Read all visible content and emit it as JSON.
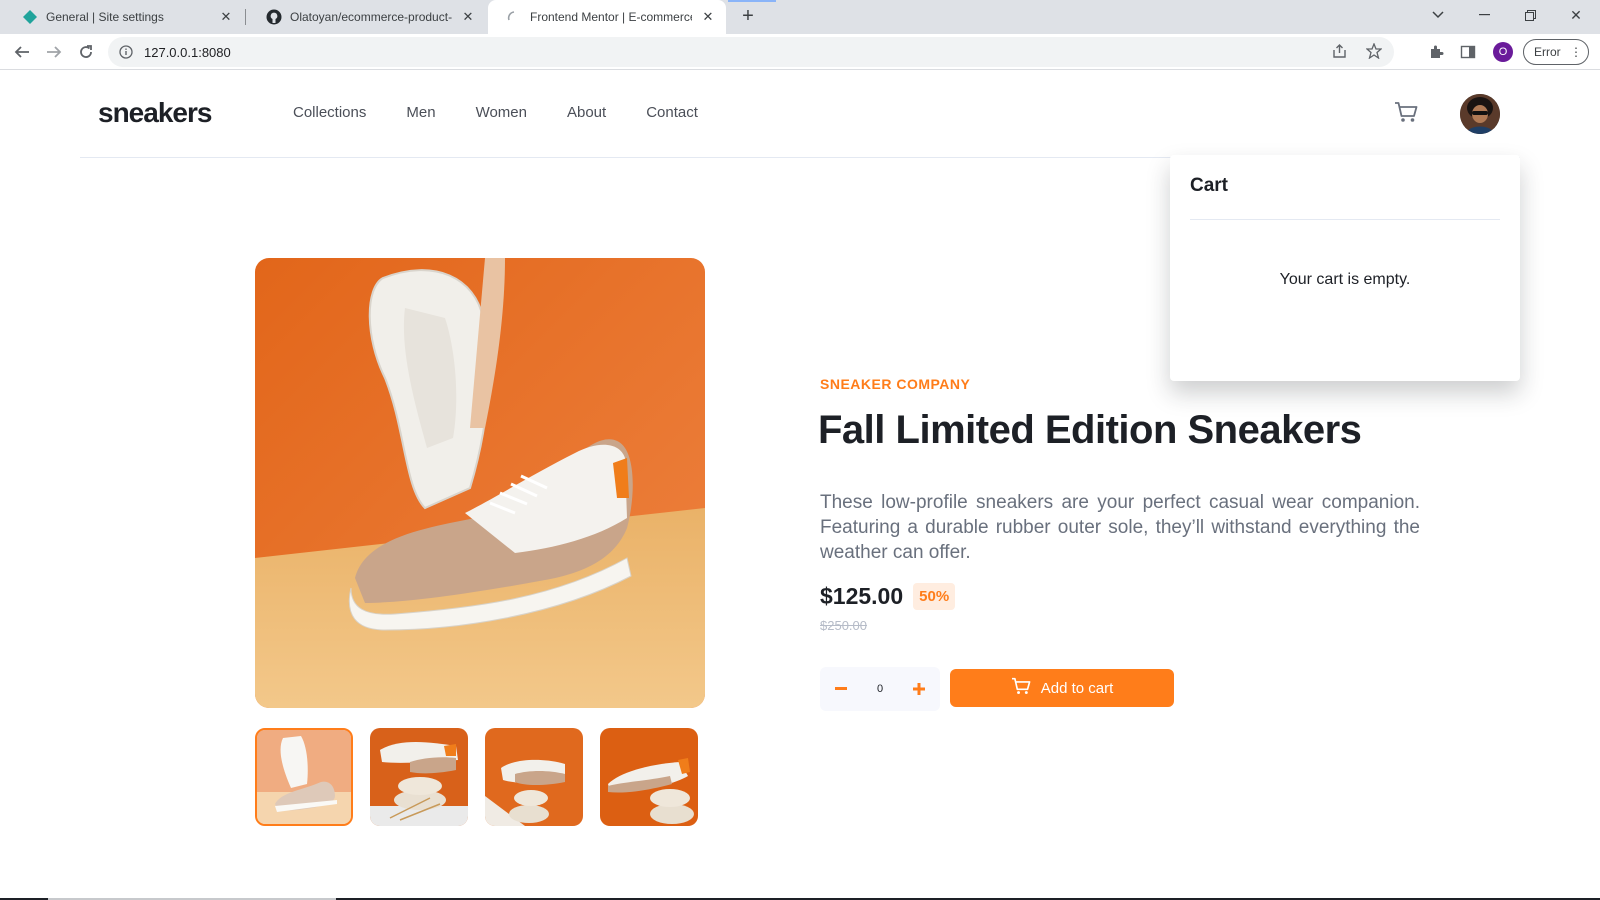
{
  "browser": {
    "tabs": [
      {
        "title": "General | Site settings",
        "icon": "netlify-icon"
      },
      {
        "title": "Olatoyan/ecommerce-product-p",
        "icon": "github-icon"
      },
      {
        "title": "Frontend Mentor | E-commerce p",
        "icon": "loading-icon"
      }
    ],
    "url": "127.0.0.1:8080",
    "profile_initial": "O",
    "error_label": "Error"
  },
  "site": {
    "logo": "sneakers",
    "nav": [
      "Collections",
      "Men",
      "Women",
      "About",
      "Contact"
    ]
  },
  "product": {
    "company": "SNEAKER COMPANY",
    "title": "Fall Limited Edition Sneakers",
    "description": "These low-profile sneakers are your perfect casual wear companion. Featuring a durable rubber outer sole, they’ll withstand everything the weather can offer.",
    "price": "$125.00",
    "discount": "50%",
    "original_price": "$250.00",
    "quantity": "0",
    "add_to_cart_label": "Add to cart",
    "active_thumbnail": 1
  },
  "cart": {
    "title": "Cart",
    "empty_message": "Your cart is empty."
  },
  "colors": {
    "accent": "#ff7d1a",
    "accent_pale": "#ffede0",
    "text_dark": "#1d2026",
    "text_grey": "#69707d"
  }
}
